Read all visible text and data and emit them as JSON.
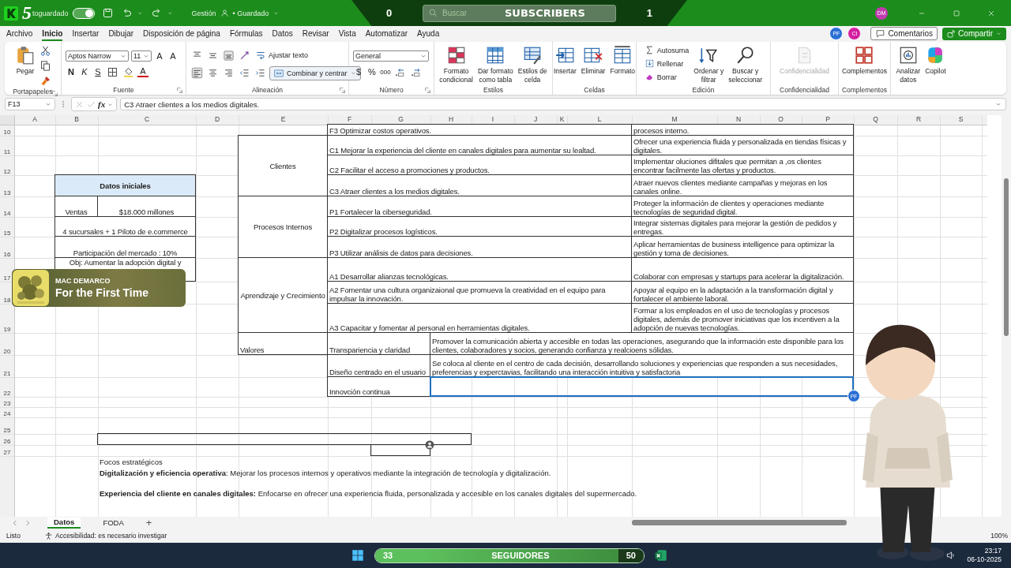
{
  "title_bar": {
    "logo_number": "5",
    "autosave_label": "toguardado",
    "autosave_on": true,
    "file_name": "Gestión",
    "save_status": "• Guardado",
    "user_initials": "DM"
  },
  "stream_overlay": {
    "left_count": "0",
    "search_placeholder": "Buscar",
    "label": "SUBSCRIBERS",
    "right_count": "1"
  },
  "menu": {
    "tabs": [
      {
        "label": "Archivo",
        "selected": false
      },
      {
        "label": "Inicio",
        "selected": true
      },
      {
        "label": "Insertar",
        "selected": false
      },
      {
        "label": "Dibujar",
        "selected": false
      },
      {
        "label": "Disposición de página",
        "selected": false
      },
      {
        "label": "Fórmulas",
        "selected": false
      },
      {
        "label": "Datos",
        "selected": false
      },
      {
        "label": "Revisar",
        "selected": false
      },
      {
        "label": "Vista",
        "selected": false
      },
      {
        "label": "Automatizar",
        "selected": false
      },
      {
        "label": "Ayuda",
        "selected": false
      }
    ],
    "collaborators": [
      {
        "initials": "PF",
        "color": "#2b6fd6"
      },
      {
        "initials": "CI",
        "color": "#d41f9f"
      }
    ],
    "comments": "Comentarios",
    "share": "Compartir"
  },
  "ribbon": {
    "groups": [
      {
        "title": "Portapapeles",
        "controls": [
          {
            "label": "Pegar",
            "disabled": false
          }
        ]
      },
      {
        "title": "Fuente",
        "font": "Aptos Narrow",
        "size": "11",
        "controls": [
          {
            "label": "A"
          },
          {
            "label": "A"
          },
          {
            "label": "N"
          },
          {
            "label": "K"
          },
          {
            "label": "S"
          },
          {
            "label": "A"
          }
        ]
      },
      {
        "title": "Alineación",
        "controls": [
          {
            "label": "Ajustar texto"
          },
          {
            "label": "Combinar y centrar"
          }
        ]
      },
      {
        "title": "Número",
        "format": "General",
        "controls": [
          {
            "label": "$"
          },
          {
            "label": "%"
          },
          {
            "label": "000"
          }
        ]
      },
      {
        "title": "Estilos",
        "controls": [
          {
            "label": "Formato\ncondicional",
            "disabled": false
          },
          {
            "label": "Dar formato\ncomo tabla",
            "disabled": false
          },
          {
            "label": "Estilos de\ncelda",
            "disabled": false
          }
        ]
      },
      {
        "title": "Celdas",
        "controls": [
          {
            "label": "Insertar",
            "disabled": false
          },
          {
            "label": "Eliminar",
            "disabled": false
          },
          {
            "label": "Formato",
            "disabled": false
          }
        ]
      },
      {
        "title": "Edición",
        "controls": [
          {
            "label": "Autosuma"
          },
          {
            "label": "Rellenar"
          },
          {
            "label": "Borrar"
          },
          {
            "label": "Ordenar y\nfiltrar",
            "disabled": false
          },
          {
            "label": "Buscar y\nseleccionar",
            "disabled": false
          }
        ]
      },
      {
        "title": "Confidencialidad",
        "controls": [
          {
            "label": "Confidencialidad",
            "disabled": true
          }
        ]
      },
      {
        "title": "Complementos",
        "controls": [
          {
            "label": "Complementos",
            "disabled": false
          }
        ]
      },
      {
        "controls": [
          {
            "label": "Analizar\ndatos",
            "disabled": false
          },
          {
            "label": "Copilot",
            "disabled": false
          }
        ]
      }
    ]
  },
  "formula_bar": {
    "name_box": "F13",
    "fx": "fx",
    "formula": "C3 Atraer clientes a los medios digitales."
  },
  "sheet": {
    "columns": [
      "A",
      "B",
      "C",
      "D",
      "E",
      "F",
      "G",
      "H",
      "I",
      "J",
      "K",
      "L",
      "M",
      "N",
      "O",
      "P",
      "Q",
      "R",
      "S"
    ],
    "rows": [
      "10",
      "11",
      "12",
      "13",
      "14",
      "15",
      "16",
      "17",
      "18",
      "19",
      "20",
      "21",
      "22",
      "23",
      "24",
      "25",
      "26",
      "27"
    ],
    "cells": [
      {
        "kind": "label",
        "text": "Clientes",
        "selected": false
      },
      {
        "kind": "label",
        "text": "Procesos Internos",
        "selected": false
      },
      {
        "kind": "label",
        "text": "Aprendizaje y Crecimiento",
        "selected": false
      },
      {
        "kind": "text",
        "text": "Valores",
        "selected": false
      },
      {
        "kind": "text",
        "text": "F3 Optimizar costos operativos.",
        "selected": false
      },
      {
        "kind": "text",
        "text": "procesos interno.",
        "selected": false
      },
      {
        "kind": "text",
        "text": "C1  Mejorar la experiencia del cliente en canales digitales para aumentar su lealtad.",
        "selected": false
      },
      {
        "kind": "text",
        "text": "Ofrecer una experiencia fluida y personalizada en tiendas físicas y digitales.",
        "selected": false
      },
      {
        "kind": "text",
        "text": "C2  Facilitar el acceso a promociones y productos.",
        "selected": false
      },
      {
        "kind": "text",
        "text": "Implementar oluciones difitales que permitan a ,os clientes encontrar facilmente las ofertas y productos.",
        "selected": false
      },
      {
        "kind": "text",
        "text": "C3 Atraer clientes a los medios digitales.",
        "selected": false
      },
      {
        "kind": "text",
        "text": "Atraer nuevos clientes mediante campañas y mejoras en los canales online.",
        "selected": false
      },
      {
        "kind": "text",
        "text": "P1 Fortalecer la ciberseguridad.",
        "selected": false
      },
      {
        "kind": "text",
        "text": "Proteger la información de clientes y operaciones mediante tecnologías de seguridad digital.",
        "selected": false
      },
      {
        "kind": "text",
        "text": "P2  Digitalizar procesos logísticos.",
        "selected": false
      },
      {
        "kind": "text",
        "text": "Integrar sistemas digitales para mejorar la gestión de pedidos y entregas.",
        "selected": false
      },
      {
        "kind": "text",
        "text": "P3 Utilizar análisis de datos para decisiones.",
        "selected": false
      },
      {
        "kind": "text",
        "text": "Aplicar herramientas de business intelligence para optimizar la gestión y toma de decisiones.",
        "selected": false
      },
      {
        "kind": "text",
        "text": "A1 Desarrollar alianzas tecnológicas.",
        "selected": false
      },
      {
        "kind": "text",
        "text": "Colaborar con empresas y startups para acelerar la digitalización.",
        "selected": false
      },
      {
        "kind": "text",
        "text": "A2  Fomentar una cultura organizaional que promueva la creatividad en el equipo para impulsar la innovación.",
        "selected": false
      },
      {
        "kind": "text",
        "text": "Apoyar al equipo en la adaptación a la transformación digital y fortalecer el ambiente laboral.",
        "selected": false
      },
      {
        "kind": "text",
        "text": "A3 Capacitar y fomentar al personal en herramientas digitales.",
        "selected": false
      },
      {
        "kind": "text",
        "text": "Formar a los empleados en el uso de tecnologías y procesos digitales, además de promover iniciativas que los incentiven a la adopción de nuevas tecnologías.",
        "selected": false
      },
      {
        "kind": "text",
        "text": "Transpariencia y claridad",
        "selected": false
      },
      {
        "kind": "text",
        "text": "Promover la comunicación abierta y accesible en todas las operaciones, asegurando que la información este disponible para los clientes, colaboradores y socios, generando confianza y realcioens sólidas.",
        "selected": false
      },
      {
        "kind": "text",
        "text": "Diseño centrado en el usuario",
        "selected": false
      },
      {
        "kind": "text",
        "text": "Se coloca al cliente en el centro de cada decisión, desarrollando soluciones y experiencias que responden a sus necesidades, preferencias y experctavias, facilitando una interacción intuitiva y satisfactoria",
        "selected": false
      },
      {
        "kind": "text",
        "text": "Innovción continua",
        "selected": false
      },
      {
        "kind": "box",
        "selected": true
      },
      {
        "kind": "title",
        "text": "Datos iniciales",
        "selected": false
      },
      {
        "kind": "center",
        "text": "Ventas",
        "selected": false
      },
      {
        "kind": "center",
        "text": "$18.000 millones",
        "selected": false
      },
      {
        "kind": "center",
        "text": "4 sucursales + 1 Piloto de e.commerce",
        "selected": false
      },
      {
        "kind": "center",
        "text": "Participación del mercado : 10%",
        "selected": false
      },
      {
        "kind": "topcenter",
        "text": "Obj: Aumentar la adopción digital y",
        "selected": false
      },
      {
        "kind": "box",
        "selected": false
      },
      {
        "kind": "box",
        "selected": false
      }
    ],
    "cursor_tag": "PF",
    "notes": [
      "Focos estratégicos",
      "**Digitalización y eficiencia operativa**: Mejorar los procesos internos y operativos mediante la integración de tecnología y digitalización.",
      "**Experiencia del cliente en canales digitales:** Enfocarse en ofrecer una experiencia fluida, personalizada y accesible en los canales digitales del supermercado."
    ]
  },
  "sheet_tabs": [
    {
      "label": "Datos",
      "selected": true
    },
    {
      "label": "FODA",
      "selected": false
    }
  ],
  "add_sheet": "+",
  "status_bar": {
    "ready": "Listo",
    "accessibility": "Accesibilidad: es necesario investigar",
    "zoom": "100%"
  },
  "now_playing": {
    "artist": "MAC DEMARCO",
    "title": "For the First Time"
  },
  "followers": {
    "left_count": "33",
    "label": "SEGUIDORES",
    "right_count": "50"
  },
  "clock": {
    "time": "23:17",
    "date": "06-10-2025"
  }
}
